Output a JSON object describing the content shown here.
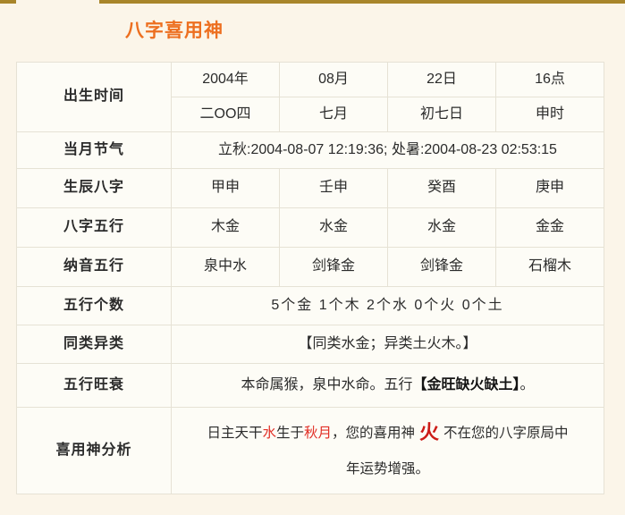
{
  "page": {
    "title": "八字喜用神",
    "title_color": "#ed6f20",
    "background_color": "#fbf5e9",
    "top_rule_color": "#a8852a",
    "highlight_red": "#e23027"
  },
  "table": {
    "rows": {
      "birth_time": {
        "label": "出生时间",
        "solar": [
          "2004年",
          "08月",
          "22日",
          "16点"
        ],
        "lunar": [
          "二OO四",
          "七月",
          "初七日",
          "申时"
        ]
      },
      "solar_terms": {
        "label": "当月节气",
        "value": "立秋:2004-08-07 12:19:36; 处暑:2004-08-23 02:53:15"
      },
      "eight_characters": {
        "label": "生辰八字",
        "values": [
          "甲申",
          "壬申",
          "癸酉",
          "庚申"
        ]
      },
      "five_elements": {
        "label": "八字五行",
        "values": [
          "木金",
          "水金",
          "水金",
          "金金"
        ]
      },
      "nayin": {
        "label": "纳音五行",
        "values": [
          "泉中水",
          "剑锋金",
          "剑锋金",
          "石榴木"
        ]
      },
      "element_counts": {
        "label": "五行个数",
        "value": "5个金  1个木  2个水  0个火  0个土"
      },
      "same_different": {
        "label": "同类异类",
        "value": "【同类水金；异类土火木。】"
      },
      "prosperity": {
        "label": "五行旺衰",
        "prefix": "本命属猴，泉中水命。五行",
        "emphasis": "【金旺缺火缺土】",
        "suffix": "。"
      },
      "favorable_god": {
        "label": "喜用神分析",
        "line1_part1": "日主天干",
        "line1_water": "水",
        "line1_part2": "生于",
        "line1_autumn": "秋月",
        "line1_part3": "，您的喜用神",
        "line1_fire": "火",
        "line1_part4": "不在您的八字原局中",
        "line2": "年运势增强。"
      }
    }
  }
}
